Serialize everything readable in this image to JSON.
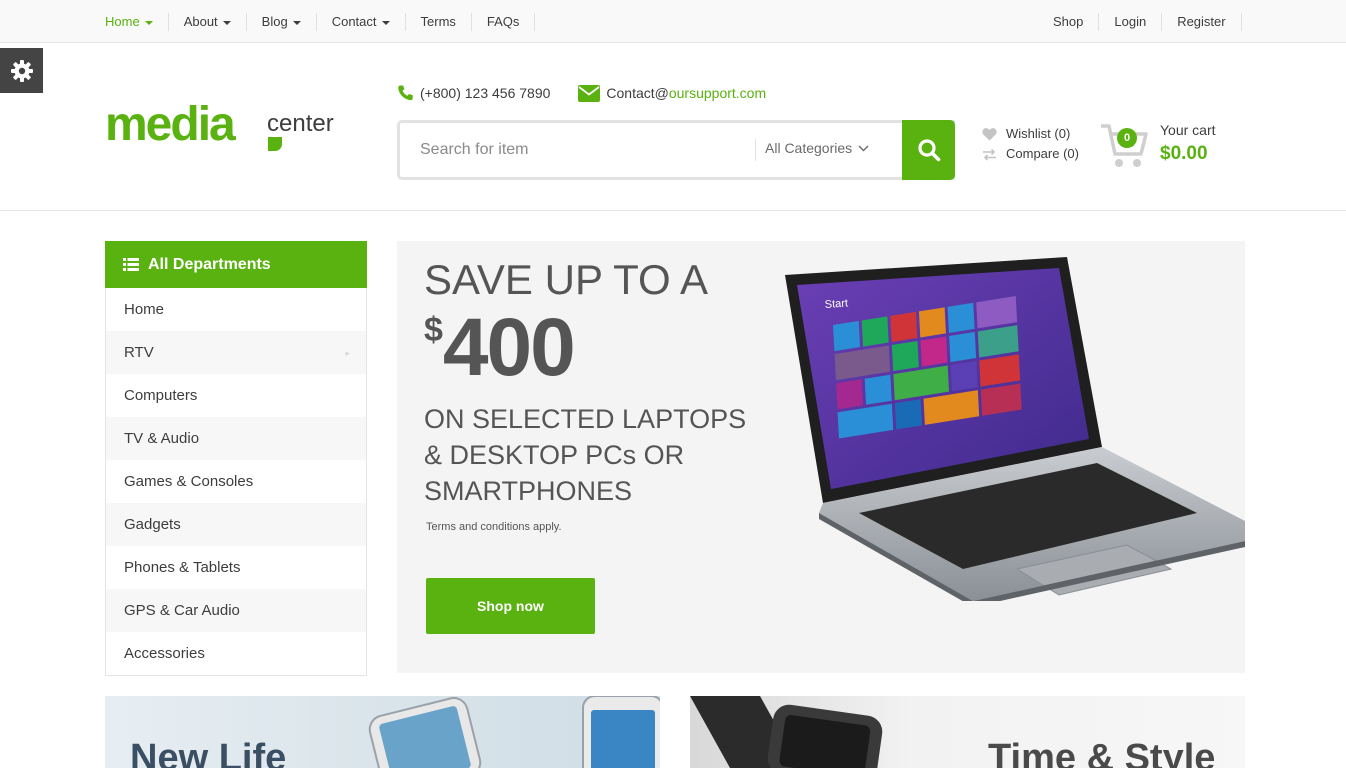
{
  "topnav": {
    "left": [
      {
        "label": "Home",
        "caret": true,
        "active": true
      },
      {
        "label": "About",
        "caret": true
      },
      {
        "label": "Blog",
        "caret": true
      },
      {
        "label": "Contact",
        "caret": true
      },
      {
        "label": "Terms",
        "caret": false
      },
      {
        "label": "FAQs",
        "caret": false
      }
    ],
    "right": [
      {
        "label": "Shop"
      },
      {
        "label": "Login"
      },
      {
        "label": "Register"
      }
    ]
  },
  "logo": {
    "main": "media",
    "secondary": "center"
  },
  "contact": {
    "phone": "(+800) 123 456 7890",
    "email_prefix": "Contact@",
    "email_domain": "oursupport.com"
  },
  "search": {
    "placeholder": "Search for item",
    "category": "All Categories"
  },
  "wishlist": {
    "label": "Wishlist (0)"
  },
  "compare": {
    "label": "Compare (0)"
  },
  "cart": {
    "count": "0",
    "label": "Your cart",
    "amount": "$0.00"
  },
  "departments": {
    "title": "All Departments",
    "items": [
      {
        "label": "Home"
      },
      {
        "label": "RTV",
        "has_sub": true
      },
      {
        "label": "Computers"
      },
      {
        "label": "TV & Audio"
      },
      {
        "label": "Games & Consoles"
      },
      {
        "label": "Gadgets"
      },
      {
        "label": "Phones & Tablets"
      },
      {
        "label": "GPS & Car Audio"
      },
      {
        "label": "Accessories"
      }
    ]
  },
  "hero": {
    "headline": "SAVE UP TO A",
    "currency": "$",
    "amount": "400",
    "subline": "ON SELECTED LAPTOPS & DESKTOP PCs OR SMARTPHONES",
    "terms": "Terms and conditions apply.",
    "button": "Shop now",
    "laptop_screen_label": "Start"
  },
  "banners": [
    {
      "title": "New Life"
    },
    {
      "title": "Time & Style"
    }
  ],
  "colors": {
    "accent": "#59b210",
    "text": "#3d3d3d"
  }
}
